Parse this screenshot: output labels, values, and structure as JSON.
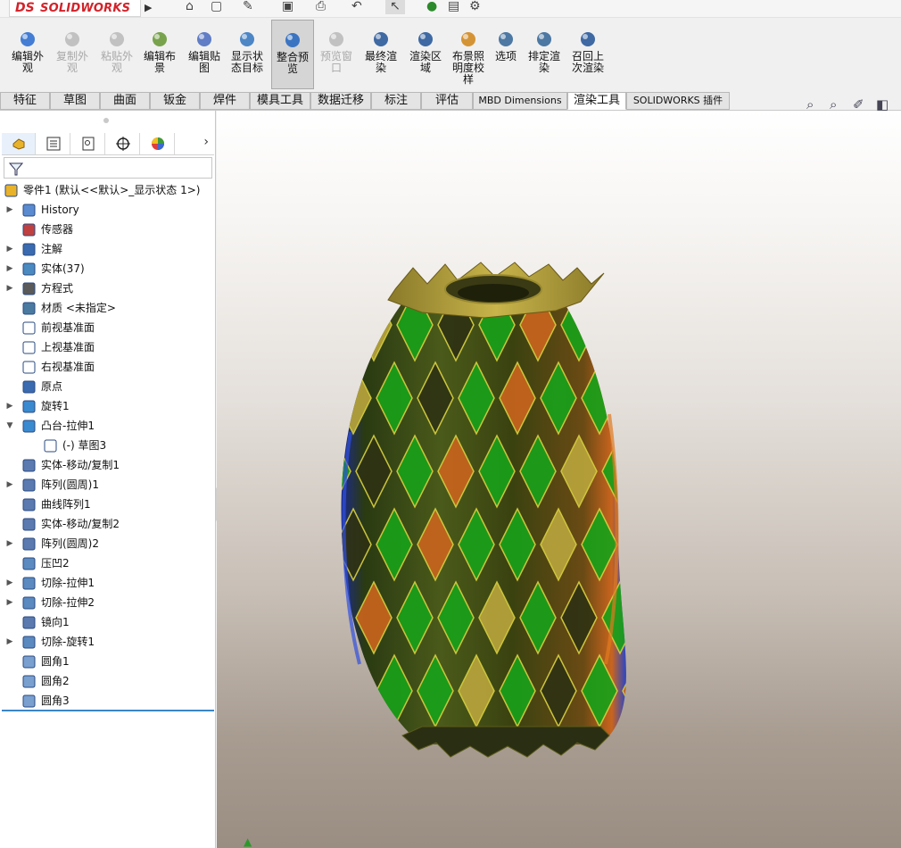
{
  "app": {
    "logo_text": "SOLIDWORKS",
    "logo_mark": "DS"
  },
  "quick_access": [
    "home-icon",
    "new-document-icon",
    "sketch-icon",
    "save-icon",
    "print-icon",
    "undo-icon",
    "select-icon",
    "traffic-light-icon",
    "file-properties-icon",
    "options-gear-icon"
  ],
  "toolbar": {
    "buttons": [
      {
        "label": "编辑外\n观",
        "icon": "edit-appearance-icon",
        "enabled": true
      },
      {
        "label": "复制外\n观",
        "icon": "copy-appearance-icon",
        "enabled": false
      },
      {
        "label": "粘贴外\n观",
        "icon": "paste-appearance-icon",
        "enabled": false
      },
      {
        "label": "编辑布\n景",
        "icon": "edit-scene-icon",
        "enabled": true
      },
      {
        "label": "编辑贴\n图",
        "icon": "edit-decal-icon",
        "enabled": true
      },
      {
        "label": "显示状\n态目标",
        "icon": "display-state-target-icon",
        "enabled": true
      },
      {
        "label": "整合预\n览",
        "icon": "integrated-preview-icon",
        "enabled": true,
        "active": true
      },
      {
        "label": "预览窗\n口",
        "icon": "preview-window-icon",
        "enabled": false
      },
      {
        "label": "最终渲\n染",
        "icon": "final-render-icon",
        "enabled": true
      },
      {
        "label": "渲染区\n域",
        "icon": "render-region-icon",
        "enabled": true
      },
      {
        "label": "布景照\n明度校\n样",
        "icon": "scene-illumination-proof-icon",
        "enabled": true
      },
      {
        "label": "选项",
        "icon": "options-icon",
        "enabled": true
      },
      {
        "label": "排定渲\n染",
        "icon": "schedule-render-icon",
        "enabled": true
      },
      {
        "label": "召回上\n次渲染",
        "icon": "recall-last-render-icon",
        "enabled": true
      }
    ]
  },
  "tabs": [
    {
      "label": "特征"
    },
    {
      "label": "草图"
    },
    {
      "label": "曲面"
    },
    {
      "label": "钣金"
    },
    {
      "label": "焊件"
    },
    {
      "label": "模具工具"
    },
    {
      "label": "数据迁移"
    },
    {
      "label": "标注"
    },
    {
      "label": "评估"
    },
    {
      "label": "MBD Dimensions"
    },
    {
      "label": "渲染工具",
      "active": true
    },
    {
      "label": "SOLIDWORKS 插件"
    }
  ],
  "view_tools": [
    "zoom-to-fit-icon",
    "zoom-to-area-icon",
    "previous-view-icon",
    "section-view-icon"
  ],
  "feature_manager": {
    "panel_tabs": [
      "feature-manager-tab-icon",
      "property-manager-tab-icon",
      "configuration-manager-tab-icon",
      "dimxpert-manager-tab-icon",
      "display-manager-tab-icon"
    ],
    "filter_icon": "filter-icon",
    "tree": [
      {
        "label": "零件1  (默认<<默认>_显示状态 1>)",
        "icon": "part-icon",
        "level": 0,
        "expander": ""
      },
      {
        "label": "History",
        "icon": "history-icon",
        "level": 1,
        "expander": "▶"
      },
      {
        "label": "传感器",
        "icon": "sensor-icon",
        "level": 1,
        "expander": ""
      },
      {
        "label": "注解",
        "icon": "annotation-icon",
        "level": 1,
        "expander": "▶"
      },
      {
        "label": "实体(37)",
        "icon": "solid-bodies-icon",
        "level": 1,
        "expander": "▶"
      },
      {
        "label": "方程式",
        "icon": "equations-icon",
        "level": 1,
        "expander": "▶"
      },
      {
        "label": "材质 <未指定>",
        "icon": "material-icon",
        "level": 1,
        "expander": ""
      },
      {
        "label": "前视基准面",
        "icon": "plane-icon",
        "level": 1,
        "expander": ""
      },
      {
        "label": "上视基准面",
        "icon": "plane-icon",
        "level": 1,
        "expander": ""
      },
      {
        "label": "右视基准面",
        "icon": "plane-icon",
        "level": 1,
        "expander": ""
      },
      {
        "label": "原点",
        "icon": "origin-icon",
        "level": 1,
        "expander": ""
      },
      {
        "label": "旋转1",
        "icon": "revolve-icon",
        "level": 1,
        "expander": "▶"
      },
      {
        "label": "凸台-拉伸1",
        "icon": "boss-extrude-icon",
        "level": 1,
        "expander": "▼"
      },
      {
        "label": "(-) 草图3",
        "icon": "sketch-icon",
        "level": 2,
        "expander": ""
      },
      {
        "label": "实体-移动/复制1",
        "icon": "move-copy-body-icon",
        "level": 1,
        "expander": ""
      },
      {
        "label": "阵列(圆周)1",
        "icon": "circular-pattern-icon",
        "level": 1,
        "expander": "▶"
      },
      {
        "label": "曲线阵列1",
        "icon": "curve-pattern-icon",
        "level": 1,
        "expander": ""
      },
      {
        "label": "实体-移动/复制2",
        "icon": "move-copy-body-icon",
        "level": 1,
        "expander": ""
      },
      {
        "label": "阵列(圆周)2",
        "icon": "circular-pattern-icon",
        "level": 1,
        "expander": "▶"
      },
      {
        "label": "压凹2",
        "icon": "indent-icon",
        "level": 1,
        "expander": ""
      },
      {
        "label": "切除-拉伸1",
        "icon": "cut-extrude-icon",
        "level": 1,
        "expander": "▶"
      },
      {
        "label": "切除-拉伸2",
        "icon": "cut-extrude-icon",
        "level": 1,
        "expander": "▶"
      },
      {
        "label": "镜向1",
        "icon": "mirror-icon",
        "level": 1,
        "expander": ""
      },
      {
        "label": "切除-旋转1",
        "icon": "cut-revolve-icon",
        "level": 1,
        "expander": "▶"
      },
      {
        "label": "圆角1",
        "icon": "fillet-icon",
        "level": 1,
        "expander": ""
      },
      {
        "label": "圆角2",
        "icon": "fillet-icon",
        "level": 1,
        "expander": ""
      },
      {
        "label": "圆角3",
        "icon": "fillet-icon",
        "level": 1,
        "expander": ""
      }
    ]
  },
  "viewport": {
    "model": "faceted-vase-model",
    "colors": {
      "green": "#1aa01a",
      "gold": "#b8a43c",
      "dark": "#2f3214",
      "orange": "#c8641e",
      "blue": "#2846c8"
    }
  }
}
